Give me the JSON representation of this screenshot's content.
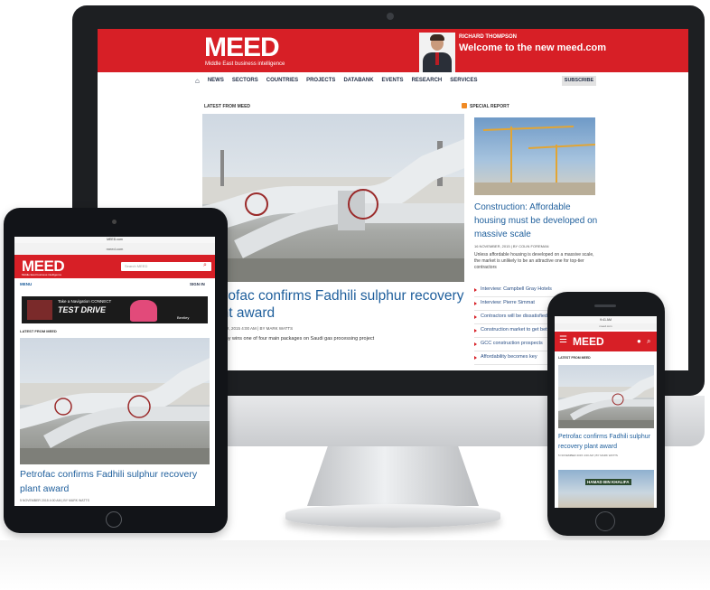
{
  "monitor": {
    "header": {
      "logo": "MEED",
      "tagline": "Middle East business intelligence",
      "name": "RICHARD THOMPSON",
      "welcome": "Welcome to the new meed.com"
    },
    "nav": {
      "items": [
        "NEWS",
        "SECTORS",
        "COUNTRIES",
        "PROJECTS",
        "DATABANK",
        "EVENTS",
        "RESEARCH",
        "SERVICES"
      ],
      "subscribe": "SUBSCRIBE"
    },
    "latest_label": "LATEST FROM MEED",
    "special_label": "SPECIAL REPORT",
    "lead": {
      "headline": "Petrofac confirms Fadhili sulphur recovery plant award",
      "meta": "5 NOVEMBER, 2015 4:00 AM | BY MARK WATTS",
      "summary": "UK company wins one of four main packages on Saudi gas processing project"
    },
    "special": {
      "headline": "Construction: Affordable housing must be developed on massive scale",
      "meta": "16 NOVEMBER, 2015 | BY COLIN FOREMAN",
      "summary": "Unless affordable housing is developed on a massive scale, the market is unlikely to be an attractive one for top-tier contractors",
      "list": [
        "Interview: Campbell Gray Hotels",
        "Interview: Pierre Simmat",
        "Contractors will be dissatisfied",
        "Construction market to get better",
        "GCC construction prospects",
        "Affordability becomes key"
      ]
    }
  },
  "tablet": {
    "status": "MEED.com",
    "url": "meed.com",
    "logo": "MEED",
    "tagline": "Middle East business intelligence",
    "search_placeholder": "Search MEED",
    "menu": "MENU",
    "signin": "SIGN IN",
    "ad": {
      "line1": "Take a Navigation CONNECT",
      "line2": "TEST DRIVE",
      "brand": "Bentley"
    },
    "latest_label": "LATEST FROM MEED",
    "headline": "Petrofac confirms Fadhili sulphur recovery plant award",
    "meta": "5 NOVEMBER 2015 4:00 AM | BY MARK WATTS"
  },
  "phone": {
    "status": "9:41 AM",
    "url": "meed.com",
    "logo": "MEED",
    "latest_label": "LATEST FROM MEED",
    "headline": "Petrofac confirms Fadhili sulphur recovery plant award",
    "meta": "5 NOVEMBER 2015 4:00 AM | BY MARK WATTS",
    "img2_sign": "HAMAD BIN KHALIFA"
  },
  "colors": {
    "brand_red": "#d71f26",
    "link_blue": "#1f5f9c",
    "nav_navy": "#26324a"
  }
}
